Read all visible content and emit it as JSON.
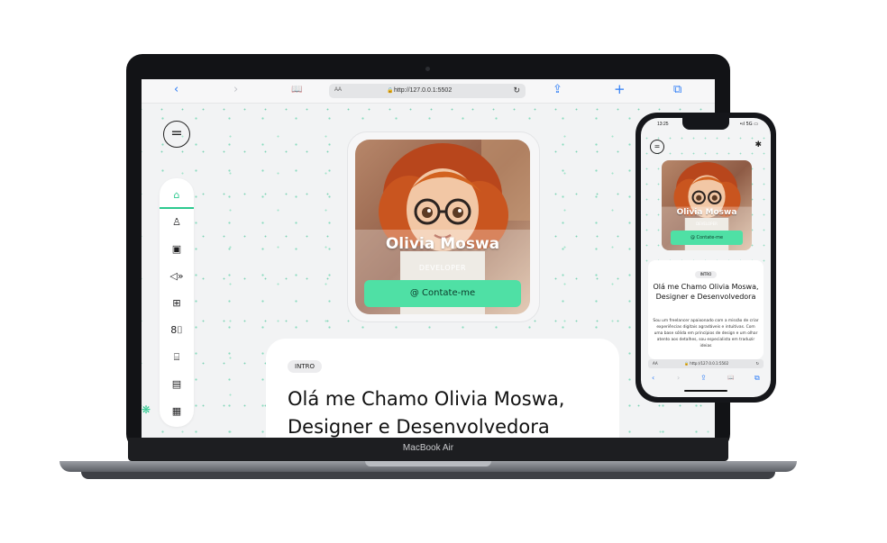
{
  "laptop": {
    "brand": "MacBook Air",
    "browser": {
      "back_icon": "‹",
      "forward_icon": "›",
      "reader_icon": "📖",
      "aa": "AA",
      "lock_icon": "🔒",
      "url": "http://127.0.0.1:5502",
      "reload_icon": "↻",
      "share_icon": "⇪",
      "add_icon": "+",
      "tabs_icon": "⧉"
    },
    "menu_icon": "=",
    "nav_items": [
      {
        "name": "home",
        "icon": "⌂"
      },
      {
        "name": "about",
        "icon": "♙"
      },
      {
        "name": "portfolio",
        "icon": "▣"
      },
      {
        "name": "skills",
        "icon": "◁»"
      },
      {
        "name": "services",
        "icon": "⊞"
      },
      {
        "name": "resume",
        "icon": "8⌷"
      },
      {
        "name": "testimonials",
        "icon": "⌸"
      },
      {
        "name": "blog",
        "icon": "▤"
      },
      {
        "name": "contact",
        "icon": "▦"
      }
    ],
    "profile": {
      "name": "Olivia Moswa",
      "role": "DEVELOPER",
      "contact_label": "@ Contate-me"
    },
    "intro": {
      "badge": "INTRO",
      "title": "Olá me Chamo Olivia Moswa, Designer e Desenvolvedora"
    }
  },
  "phone": {
    "time": "13:25",
    "status": "•ıl 5G ▭",
    "menu_icon": "=",
    "gear_icon": "✱",
    "profile": {
      "name": "Olivia Moswa",
      "role": "DEVELOPER",
      "contact_label": "@ Contate-me"
    },
    "intro": {
      "badge": "INTRO",
      "title": "Olá me Chamo Olivia Moswa, Designer e Desenvolvedora",
      "body": "Sou um freelancer apaixonado com a missão de criar experiências digitais agradáveis e intuitivas. Com uma base sólida em princípios de design e um olhar atento aos detalhes, sou especialista em traduzir ideias"
    },
    "url_aa": "AA",
    "url": "🔒 http://127.0.0.1:5502",
    "reload_icon": "↻",
    "toolbar": {
      "back": "‹",
      "forward": "›",
      "share": "⇪",
      "book": "📖",
      "tabs": "⧉"
    }
  },
  "colors": {
    "accent": "#4fe0a5",
    "accent_dark": "#2cc98f",
    "browser_blue": "#2f7ef6"
  }
}
